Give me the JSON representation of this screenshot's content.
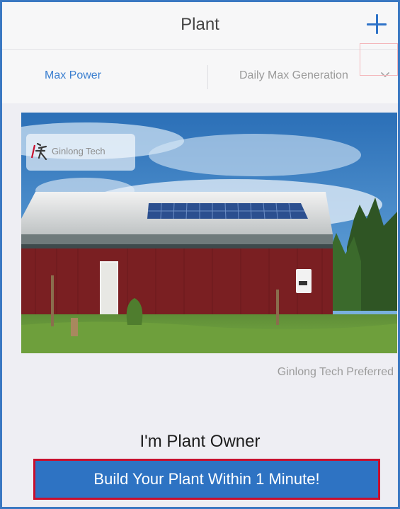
{
  "header": {
    "title": "Plant",
    "add_icon": "plus-icon"
  },
  "tabs": [
    {
      "label": "Max Power",
      "active": true
    },
    {
      "label": "Daily Max Generation",
      "active": false
    }
  ],
  "icons": {
    "dropdown": "chevron-down-icon"
  },
  "banner": {
    "logo_text": "Ginlong Tech",
    "caption": "Ginlong Tech Preferred"
  },
  "owner_section": {
    "heading": "I'm Plant Owner",
    "cta_label": "Build Your Plant Within 1 Minute!"
  },
  "colors": {
    "accent": "#2e73c3",
    "active_tab": "#3b7fd0",
    "cta_border": "#c8102e",
    "frame_border": "#3a78c2"
  }
}
